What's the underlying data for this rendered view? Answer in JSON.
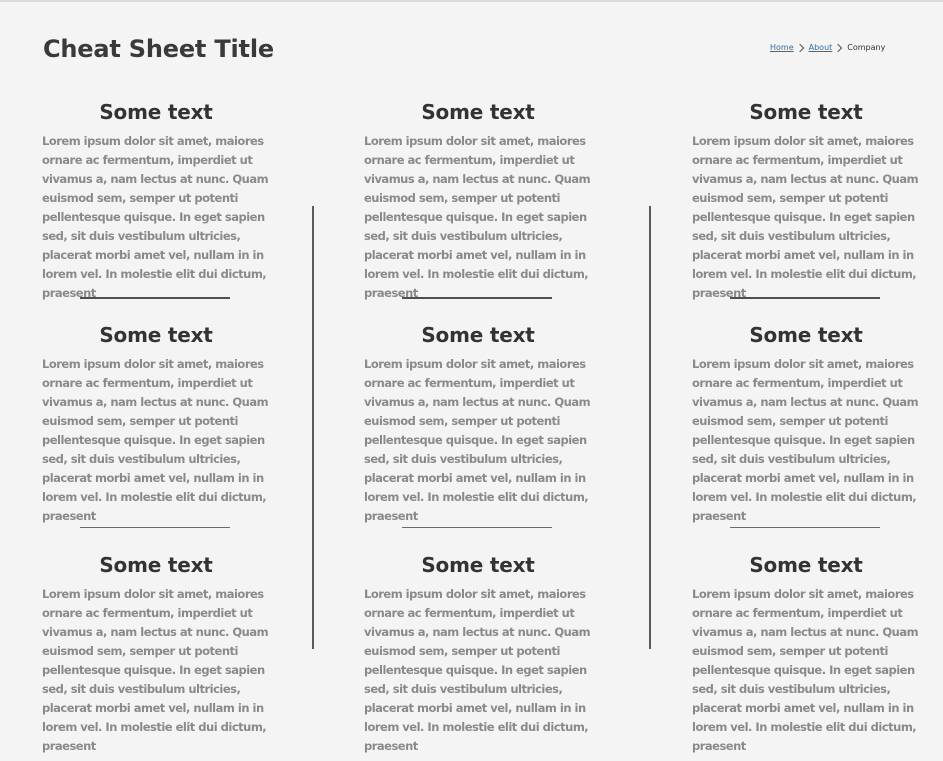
{
  "page": {
    "title": "Cheat Sheet Title"
  },
  "breadcrumb": {
    "items": [
      {
        "label": "Home"
      },
      {
        "label": "About"
      }
    ],
    "current": "Company"
  },
  "columns": [
    {
      "sections": [
        {
          "heading": "Some text",
          "body": "Lorem ipsum dolor sit amet, maiores ornare ac fermentum, imperdiet ut vivamus a, nam lectus at nunc. Quam euismod sem, semper ut potenti pellentesque quisque. In eget sapien sed, sit duis vestibulum ultricies, placerat morbi amet vel, nullam in in lorem vel. In molestie elit dui dictum, praesent"
        },
        {
          "heading": "Some text",
          "body": "Lorem ipsum dolor sit amet, maiores ornare ac fermentum, imperdiet ut vivamus a, nam lectus at nunc. Quam euismod sem, semper ut potenti pellentesque quisque. In eget sapien sed, sit duis vestibulum ultricies, placerat morbi amet vel, nullam in in lorem vel. In molestie elit dui dictum, praesent"
        },
        {
          "heading": "Some text",
          "body": "Lorem ipsum dolor sit amet, maiores ornare ac fermentum, imperdiet ut vivamus a, nam lectus at nunc. Quam euismod sem, semper ut potenti pellentesque quisque. In eget sapien sed, sit duis vestibulum ultricies, placerat morbi amet vel, nullam in in lorem vel. In molestie elit dui dictum, praesent"
        }
      ]
    },
    {
      "sections": [
        {
          "heading": "Some text",
          "body": "Lorem ipsum dolor sit amet, maiores ornare ac fermentum, imperdiet ut vivamus a, nam lectus at nunc. Quam euismod sem, semper ut potenti pellentesque quisque. In eget sapien sed, sit duis vestibulum ultricies, placerat morbi amet vel, nullam in in lorem vel. In molestie elit dui dictum, praesent"
        },
        {
          "heading": "Some text",
          "body": "Lorem ipsum dolor sit amet, maiores ornare ac fermentum, imperdiet ut vivamus a, nam lectus at nunc. Quam euismod sem, semper ut potenti pellentesque quisque. In eget sapien sed, sit duis vestibulum ultricies, placerat morbi amet vel, nullam in in lorem vel. In molestie elit dui dictum, praesent"
        },
        {
          "heading": "Some text",
          "body": "Lorem ipsum dolor sit amet, maiores ornare ac fermentum, imperdiet ut vivamus a, nam lectus at nunc. Quam euismod sem, semper ut potenti pellentesque quisque. In eget sapien sed, sit duis vestibulum ultricies, placerat morbi amet vel, nullam in in lorem vel. In molestie elit dui dictum, praesent"
        }
      ]
    },
    {
      "sections": [
        {
          "heading": "Some text",
          "body": "Lorem ipsum dolor sit amet, maiores ornare ac fermentum, imperdiet ut vivamus a, nam lectus at nunc. Quam euismod sem, semper ut potenti pellentesque quisque. In eget sapien sed, sit duis vestibulum ultricies, placerat morbi amet vel, nullam in in lorem vel. In molestie elit dui dictum, praesent"
        },
        {
          "heading": "Some text",
          "body": "Lorem ipsum dolor sit amet, maiores ornare ac fermentum, imperdiet ut vivamus a, nam lectus at nunc. Quam euismod sem, semper ut potenti pellentesque quisque. In eget sapien sed, sit duis vestibulum ultricies, placerat morbi amet vel, nullam in in lorem vel. In molestie elit dui dictum, praesent"
        },
        {
          "heading": "Some text",
          "body": "Lorem ipsum dolor sit amet, maiores ornare ac fermentum, imperdiet ut vivamus a, nam lectus at nunc. Quam euismod sem, semper ut potenti pellentesque quisque. In eget sapien sed, sit duis vestibulum ultricies, placerat morbi amet vel, nullam in in lorem vel. In molestie elit dui dictum, praesent"
        }
      ]
    }
  ]
}
